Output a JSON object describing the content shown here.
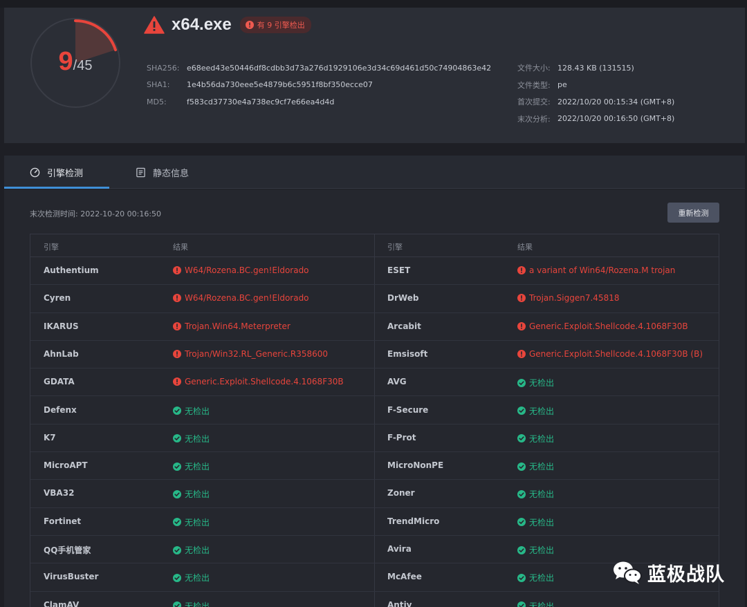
{
  "summary": {
    "detected": "9",
    "total": "/45",
    "detected_count": 9,
    "total_count": 45,
    "filename": "x64.exe",
    "badge": "有 9 引擎检出",
    "hashes": [
      {
        "key": "SHA256:",
        "value": "e68eed43e50446df8cdbb3d73a276d1929106e3d34c69d461d50c74904863e42"
      },
      {
        "key": "SHA1:",
        "value": "1e4b56da730eee5e4879b6c5951f8bf350ecce07"
      },
      {
        "key": "MD5:",
        "value": "f583cd37730e4a738ec9cf7e66ea4d4d"
      }
    ],
    "meta": [
      {
        "key": "文件大小:",
        "value": "128.43 KB (131515)"
      },
      {
        "key": "文件类型:",
        "value": "pe"
      },
      {
        "key": "首次提交:",
        "value": "2022/10/20 00:15:34 (GMT+8)"
      },
      {
        "key": "末次分析:",
        "value": "2022/10/20 00:16:50 (GMT+8)"
      }
    ]
  },
  "tabs": [
    {
      "label": "引擎检测",
      "icon": "gauge-icon",
      "active": true
    },
    {
      "label": "静态信息",
      "icon": "document-icon",
      "active": false
    }
  ],
  "scan": {
    "last_scan": "末次检测时间: 2022-10-20 00:16:50",
    "rescan_label": "重新检测"
  },
  "table": {
    "headers": {
      "engine": "引擎",
      "result": "结果"
    },
    "rows": [
      [
        {
          "engine": "Authentium",
          "result": "W64/Rozena.BC.gen!Eldorado",
          "status": "detected"
        },
        {
          "engine": "ESET",
          "result": "a variant of Win64/Rozena.M trojan",
          "status": "detected"
        }
      ],
      [
        {
          "engine": "Cyren",
          "result": "W64/Rozena.BC.gen!Eldorado",
          "status": "detected"
        },
        {
          "engine": "DrWeb",
          "result": "Trojan.Siggen7.45818",
          "status": "detected"
        }
      ],
      [
        {
          "engine": "IKARUS",
          "result": "Trojan.Win64.Meterpreter",
          "status": "detected"
        },
        {
          "engine": "Arcabit",
          "result": "Generic.Exploit.Shellcode.4.1068F30B",
          "status": "detected"
        }
      ],
      [
        {
          "engine": "AhnLab",
          "result": "Trojan/Win32.RL_Generic.R358600",
          "status": "detected"
        },
        {
          "engine": "Emsisoft",
          "result": "Generic.Exploit.Shellcode.4.1068F30B (B)",
          "status": "detected"
        }
      ],
      [
        {
          "engine": "GDATA",
          "result": "Generic.Exploit.Shellcode.4.1068F30B",
          "status": "detected"
        },
        {
          "engine": "AVG",
          "result": "无检出",
          "status": "clean"
        }
      ],
      [
        {
          "engine": "Defenx",
          "result": "无检出",
          "status": "clean"
        },
        {
          "engine": "F-Secure",
          "result": "无检出",
          "status": "clean"
        }
      ],
      [
        {
          "engine": "K7",
          "result": "无检出",
          "status": "clean"
        },
        {
          "engine": "F-Prot",
          "result": "无检出",
          "status": "clean"
        }
      ],
      [
        {
          "engine": "MicroAPT",
          "result": "无检出",
          "status": "clean"
        },
        {
          "engine": "MicroNonPE",
          "result": "无检出",
          "status": "clean"
        }
      ],
      [
        {
          "engine": "VBA32",
          "result": "无检出",
          "status": "clean"
        },
        {
          "engine": "Zoner",
          "result": "无检出",
          "status": "clean"
        }
      ],
      [
        {
          "engine": "Fortinet",
          "result": "无检出",
          "status": "clean"
        },
        {
          "engine": "TrendMicro",
          "result": "无检出",
          "status": "clean"
        }
      ],
      [
        {
          "engine": "QQ手机管家",
          "result": "无检出",
          "status": "clean"
        },
        {
          "engine": "Avira",
          "result": "无检出",
          "status": "clean"
        }
      ],
      [
        {
          "engine": "VirusBuster",
          "result": "无检出",
          "status": "clean"
        },
        {
          "engine": "McAfee",
          "result": "无检出",
          "status": "clean"
        }
      ],
      [
        {
          "engine": "ClamAV",
          "result": "无检出",
          "status": "clean"
        },
        {
          "engine": "Antiy",
          "result": "无检出",
          "status": "clean"
        }
      ]
    ]
  },
  "watermark": {
    "text": "蓝极战队",
    "icon": "wechat-icon"
  },
  "colors": {
    "danger": "#e8453c",
    "safe": "#27b888",
    "accent": "#3f8fd8"
  }
}
